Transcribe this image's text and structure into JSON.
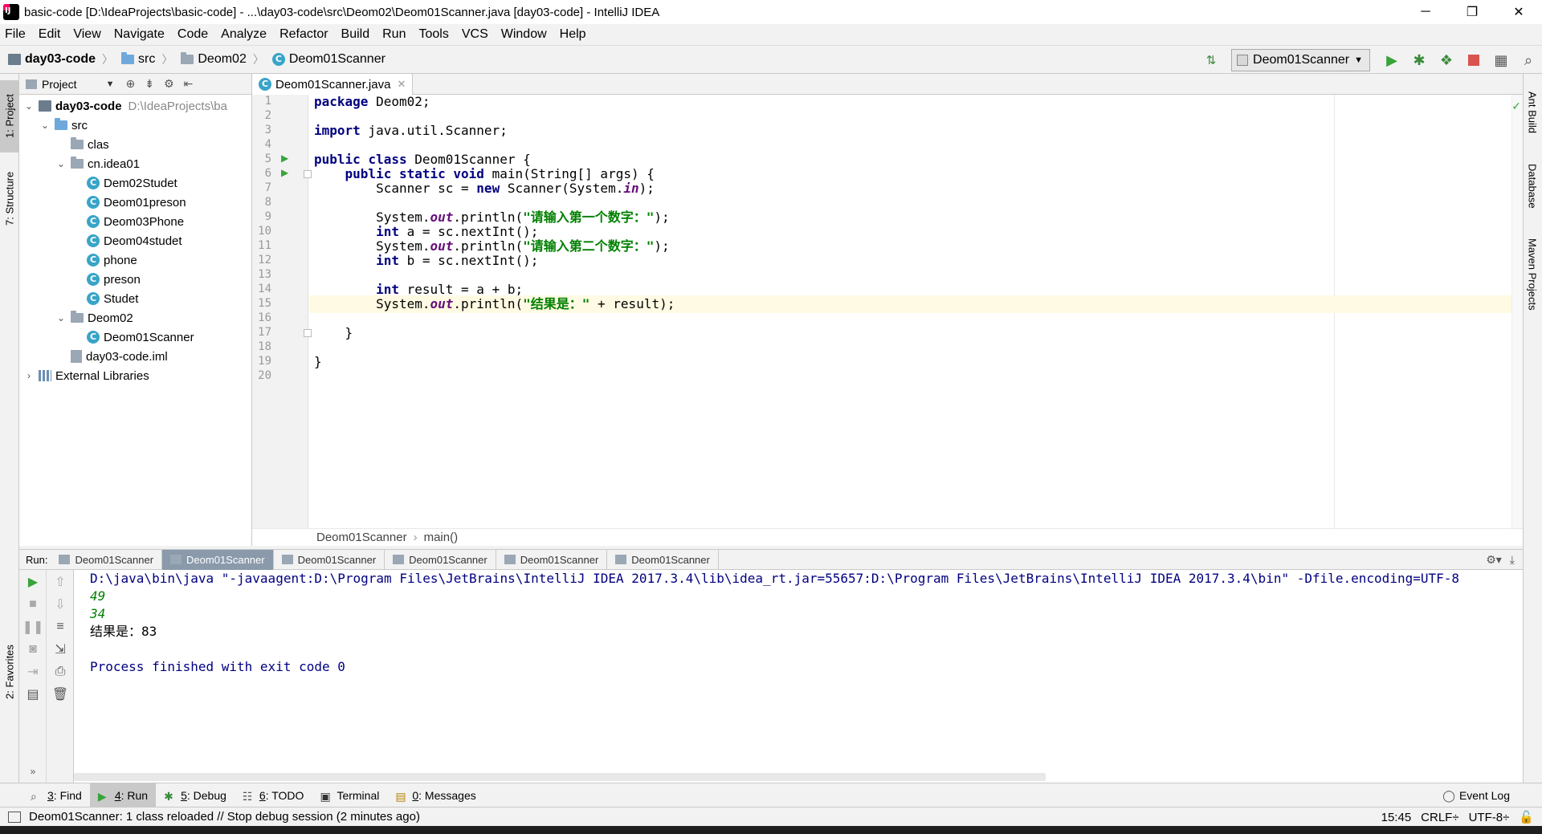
{
  "window": {
    "title": "basic-code [D:\\IdeaProjects\\basic-code] - ...\\day03-code\\src\\Deom02\\Deom01Scanner.java [day03-code] - IntelliJ IDEA",
    "minimize": "─",
    "maximize": "❐",
    "close": "✕"
  },
  "menu": [
    "File",
    "Edit",
    "View",
    "Navigate",
    "Code",
    "Analyze",
    "Refactor",
    "Build",
    "Run",
    "Tools",
    "VCS",
    "Window",
    "Help"
  ],
  "breadcrumb": {
    "module": "day03-code",
    "src": "src",
    "package": "Deom02",
    "class": "Deom01Scanner"
  },
  "run_config": "Deom01Scanner",
  "left_tabs": {
    "project": "1: Project",
    "structure": "7: Structure",
    "favorites": "2: Favorites"
  },
  "right_tabs": {
    "ant": "Ant Build",
    "database": "Database",
    "maven": "Maven Projects"
  },
  "project_panel": {
    "title": "Project",
    "tree": [
      {
        "label": "day03-code",
        "path": "D:\\IdeaProjects\\ba",
        "depth": 0,
        "arrow": "⌄",
        "icon": "module"
      },
      {
        "label": "src",
        "depth": 1,
        "arrow": "⌄",
        "icon": "folder-blue"
      },
      {
        "label": "clas",
        "depth": 2,
        "arrow": "",
        "icon": "folder"
      },
      {
        "label": "cn.idea01",
        "depth": 2,
        "arrow": "⌄",
        "icon": "folder"
      },
      {
        "label": "Dem02Studet",
        "depth": 3,
        "arrow": "",
        "icon": "class-run"
      },
      {
        "label": "Deom01preson",
        "depth": 3,
        "arrow": "",
        "icon": "class-run"
      },
      {
        "label": "Deom03Phone",
        "depth": 3,
        "arrow": "",
        "icon": "class-run"
      },
      {
        "label": "Deom04studet",
        "depth": 3,
        "arrow": "",
        "icon": "class-run"
      },
      {
        "label": "phone",
        "depth": 3,
        "arrow": "",
        "icon": "class"
      },
      {
        "label": "preson",
        "depth": 3,
        "arrow": "",
        "icon": "class"
      },
      {
        "label": "Studet",
        "depth": 3,
        "arrow": "",
        "icon": "class"
      },
      {
        "label": "Deom02",
        "depth": 2,
        "arrow": "⌄",
        "icon": "folder"
      },
      {
        "label": "Deom01Scanner",
        "depth": 3,
        "arrow": "",
        "icon": "class-run"
      },
      {
        "label": "day03-code.iml",
        "depth": 2,
        "arrow": "",
        "icon": "iml"
      },
      {
        "label": "External Libraries",
        "depth": 0,
        "arrow": "›",
        "icon": "lib"
      }
    ]
  },
  "editor": {
    "tab": "Deom01Scanner.java",
    "lines": [
      "package Deom02;",
      "",
      "import java.util.Scanner;",
      "",
      "public class Deom01Scanner {",
      "    public static void main(String[] args) {",
      "        Scanner sc = new Scanner(System.in);",
      "",
      "        System.out.println(\"请输入第一个数字：\");",
      "        int a = sc.nextInt();",
      "        System.out.println(\"请输入第二个数字：\");",
      "        int b = sc.nextInt();",
      "",
      "        int result = a + b;",
      "        System.out.println(\"结果是：\" + result);",
      "",
      "    }",
      "",
      "}",
      ""
    ],
    "current_line": 15,
    "breadcrumb_class": "Deom01Scanner",
    "breadcrumb_method": "main()"
  },
  "run_panel": {
    "label": "Run:",
    "tabs": [
      "Deom01Scanner",
      "Deom01Scanner",
      "Deom01Scanner",
      "Deom01Scanner",
      "Deom01Scanner",
      "Deom01Scanner"
    ],
    "active_tab": 1,
    "console": {
      "command": "D:\\java\\bin\\java \"-javaagent:D:\\Program Files\\JetBrains\\IntelliJ IDEA 2017.3.4\\lib\\idea_rt.jar=55657:D:\\Program Files\\JetBrains\\IntelliJ IDEA 2017.3.4\\bin\" -Dfile.encoding=UTF-8",
      "input1": "49",
      "input2": "34",
      "output": "结果是：83",
      "process": "Process finished with exit code 0"
    }
  },
  "tool_windows": [
    {
      "num": "3",
      "label": ": Find"
    },
    {
      "num": "4",
      "label": ": Run"
    },
    {
      "num": "5",
      "label": ": Debug"
    },
    {
      "num": "6",
      "label": ": TODO"
    },
    {
      "num": "",
      "label": "Terminal"
    },
    {
      "num": "0",
      "label": ": Messages"
    }
  ],
  "event_log": "Event Log",
  "status": {
    "message": "Deom01Scanner: 1 class reloaded // Stop debug session (2 minutes ago)",
    "position": "15:45",
    "line_sep": "CRLF÷",
    "encoding": "UTF-8÷"
  },
  "colors": {
    "keyword": "#000080",
    "string": "#008000",
    "field": "#660e7a",
    "current_line": "#fffae3",
    "run_tab_active": "#8a9aab"
  }
}
